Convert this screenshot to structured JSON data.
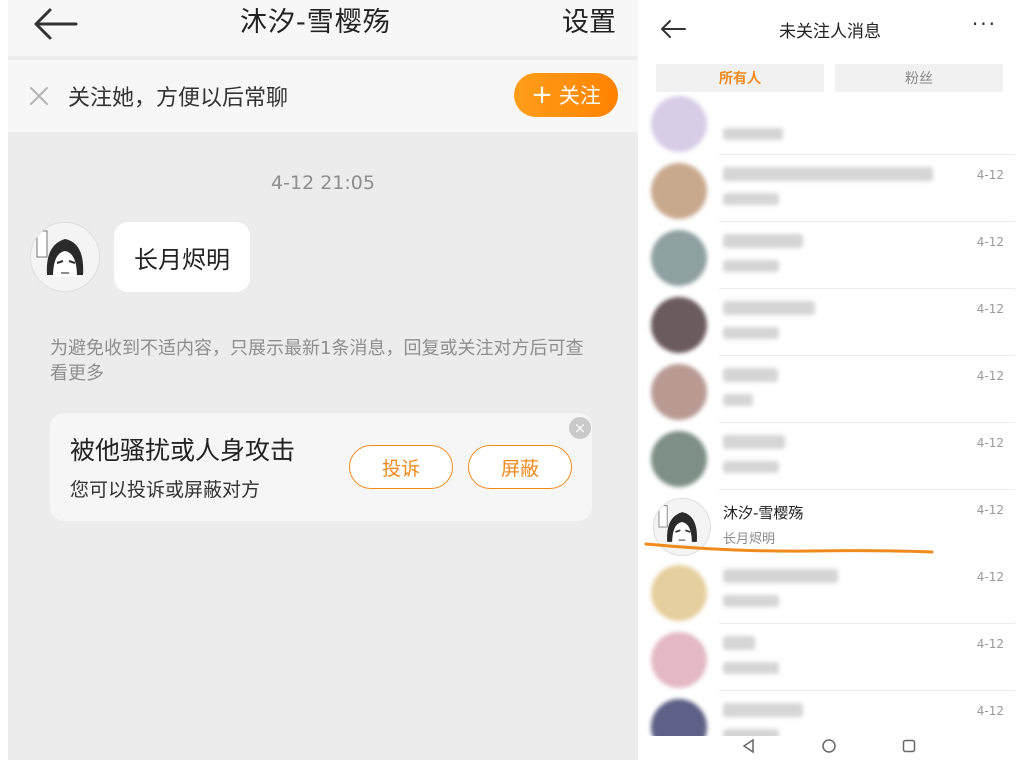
{
  "left": {
    "header": {
      "title": "沐汐-雪樱殇",
      "settings": "设置"
    },
    "follow_bar": {
      "text": "关注她，方便以后常聊",
      "button": "关注",
      "plus": "+"
    },
    "message": {
      "timestamp": "4-12 21:05",
      "text": "长月烬明"
    },
    "notice": "为避免收到不适内容，只展示最新1条消息，回复或关注对方后可查看更多",
    "harass_card": {
      "title": "被他骚扰或人身攻击",
      "subtitle": "您可以投诉或屏蔽对方",
      "complain": "投诉",
      "block": "屏蔽",
      "close": "×"
    }
  },
  "right": {
    "header": {
      "title": "未关注人消息",
      "more": "···"
    },
    "tabs": [
      {
        "label": "所有人"
      },
      {
        "label": "粉丝"
      }
    ],
    "rows": [
      {
        "date": ""
      },
      {
        "date": "4-12"
      },
      {
        "date": "4-12"
      },
      {
        "date": "4-12"
      },
      {
        "date": "4-12"
      },
      {
        "date": "4-12"
      },
      {
        "date": "4-12",
        "name": "沐汐-雪樱殇",
        "preview": "长月烬明"
      },
      {
        "date": "4-12"
      },
      {
        "date": "4-12"
      },
      {
        "date": "4-12"
      }
    ]
  },
  "colors": {
    "accent": "#ff8a00",
    "highlight_line": "#f08a1c"
  },
  "icons": [
    "back-arrow-icon",
    "close-icon",
    "plus-icon",
    "more-icon",
    "triangle-back-icon",
    "circle-home-icon",
    "square-recent-icon"
  ]
}
